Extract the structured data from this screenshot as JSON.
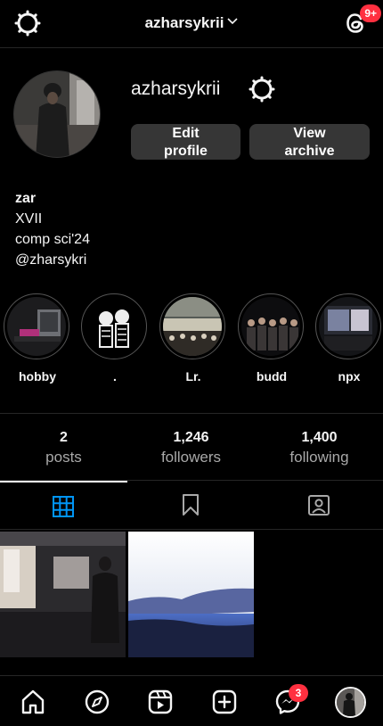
{
  "header": {
    "username": "azharsykrii",
    "threads_badge": "9+"
  },
  "profile": {
    "username": "azharsykrii",
    "edit_line1": "Edit",
    "edit_line2": "profile",
    "archive_line1": "View",
    "archive_line2": "archive"
  },
  "bio": {
    "name": "zar",
    "lines": [
      "XVII",
      "comp sci'24",
      "@zharsykri"
    ]
  },
  "highlights": [
    {
      "label": "hobby"
    },
    {
      "label": "."
    },
    {
      "label": "Lr."
    },
    {
      "label": "budd"
    },
    {
      "label": "npx"
    }
  ],
  "stats": [
    {
      "value": "2",
      "label": "posts"
    },
    {
      "value": "1,246",
      "label": "followers"
    },
    {
      "value": "1,400",
      "label": "following"
    }
  ],
  "bottom_nav": {
    "messages_badge": "3"
  },
  "colors": {
    "background": "#000000",
    "accent": "#0095f6",
    "badge": "#ff3040",
    "button": "#363636"
  },
  "icons": [
    "settings-gear-icon",
    "chevron-down-icon",
    "threads-icon",
    "grid-icon",
    "bookmark-icon",
    "tagged-icon",
    "home-icon",
    "explore-icon",
    "reels-icon",
    "create-icon",
    "messenger-icon"
  ]
}
